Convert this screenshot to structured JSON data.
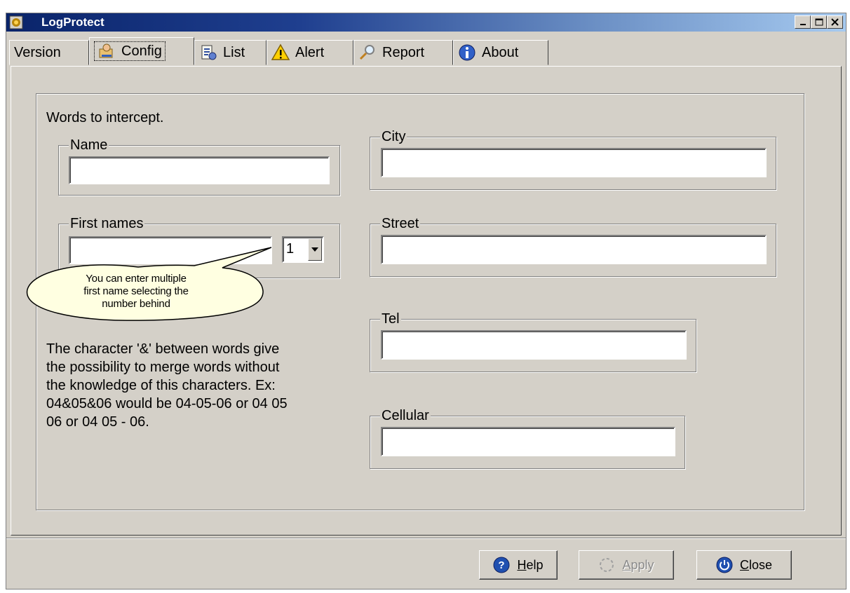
{
  "window": {
    "title": "LogProtect"
  },
  "tabs": [
    {
      "label": "Version",
      "icon": "none"
    },
    {
      "label": "Config",
      "icon": "config-icon",
      "active": true
    },
    {
      "label": "List",
      "icon": "list-icon"
    },
    {
      "label": "Alert",
      "icon": "alert-icon"
    },
    {
      "label": "Report",
      "icon": "search-icon"
    },
    {
      "label": "About",
      "icon": "info-icon"
    }
  ],
  "config": {
    "intro": "Words to intercept.",
    "name": {
      "label": "Name",
      "value": ""
    },
    "first_names": {
      "label": "First names",
      "value": "",
      "count": "1"
    },
    "tooltip": [
      "You can enter multiple",
      "first name selecting the",
      "number behind"
    ],
    "help_text": [
      "The character '&' between words give",
      "the possibility to merge words without",
      "the knowledge of this characters. Ex:",
      "04&05&06 would be 04-05-06 or 04 05",
      "06 or 04 05 - 06."
    ],
    "city": {
      "label": "City",
      "value": ""
    },
    "street": {
      "label": "Street",
      "value": ""
    },
    "tel": {
      "label": "Tel",
      "value": ""
    },
    "cellular": {
      "label": "Cellular",
      "value": ""
    }
  },
  "buttons": {
    "help": {
      "label": "Help",
      "accel": "H",
      "rest": "elp"
    },
    "apply": {
      "label": "Apply",
      "accel": "A",
      "rest": "pply",
      "enabled": false
    },
    "close": {
      "label": "Close",
      "accel": "C",
      "rest": "lose"
    }
  }
}
